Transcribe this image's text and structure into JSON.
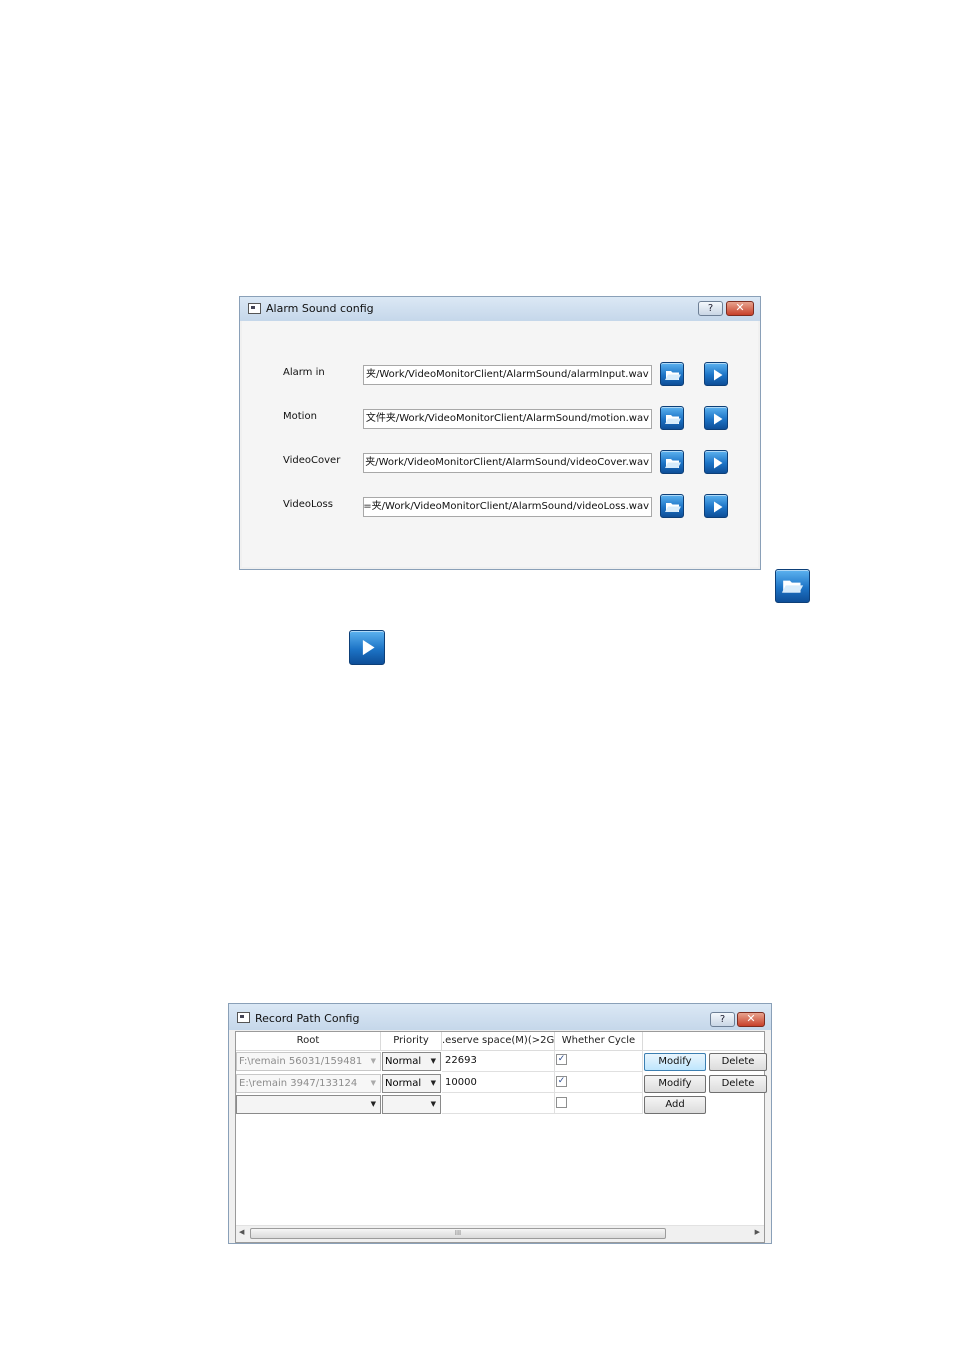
{
  "alarm_dialog": {
    "title": "Alarm Sound config",
    "help_label": "?",
    "close_label": "✕",
    "rows": [
      {
        "label": "Alarm in",
        "path": "夹/Work/VideoMonitorClient/AlarmSound/alarmInput.wav"
      },
      {
        "label": "Motion",
        "path": "文件夹/Work/VideoMonitorClient/AlarmSound/motion.wav"
      },
      {
        "label": "VideoCover",
        "path": "夹/Work/VideoMonitorClient/AlarmSound/videoCover.wav"
      },
      {
        "label": "VideoLoss",
        "path": "=夹/Work/VideoMonitorClient/AlarmSound/videoLoss.wav"
      }
    ]
  },
  "record_dialog": {
    "title": "Record Path Config",
    "help_label": "?",
    "close_label": "✕",
    "columns": [
      "Root",
      "Priority",
      ".eserve space(M)(>2G",
      "Whether Cycle"
    ],
    "rows": [
      {
        "root": "F:\\remain 56031/159481",
        "priority": "Normal",
        "reserve": "22693",
        "cycle": true,
        "buttons": [
          "Modify",
          "Delete"
        ]
      },
      {
        "root": "E:\\remain 3947/133124",
        "priority": "Normal",
        "reserve": "10000",
        "cycle": true,
        "buttons": [
          "Modify",
          "Delete"
        ]
      },
      {
        "root": "",
        "priority": "",
        "reserve": "",
        "cycle": false,
        "buttons": [
          "Add"
        ]
      }
    ],
    "scroll_grip": "III"
  },
  "icons": {
    "browse": "folder-open-icon",
    "play": "play-icon"
  }
}
